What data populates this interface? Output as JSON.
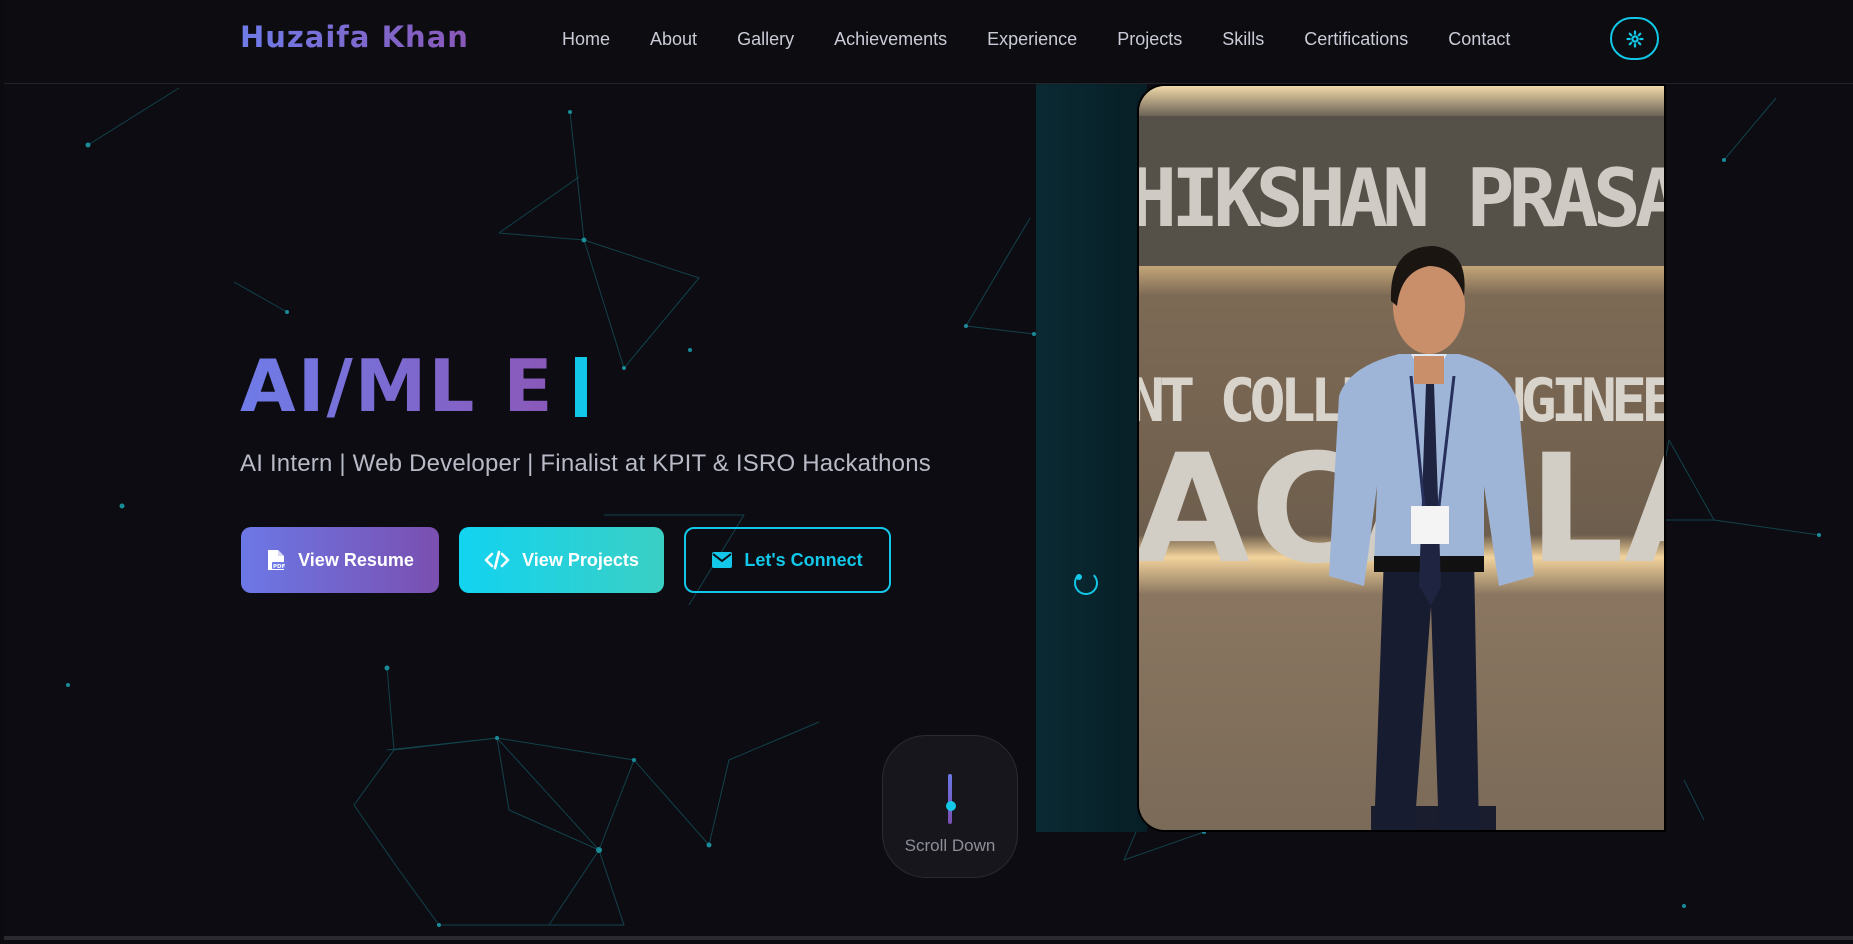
{
  "navbar": {
    "brand": "Huzaifa Khan",
    "links": [
      "Home",
      "About",
      "Gallery",
      "Achievements",
      "Experience",
      "Projects",
      "Skills",
      "Certifications",
      "Contact"
    ],
    "theme_toggle_icon": "gear-icon"
  },
  "hero": {
    "title": "AI/ML E",
    "subtitle": "AI Intern | Web Developer | Finalist at KPIT & ISRO Hackathons",
    "buttons": {
      "resume": "View Resume",
      "projects": "View Projects",
      "connect": "Let's Connect"
    },
    "scroll_label": "Scroll Down"
  },
  "photo": {
    "wall_text_top": "HIKSHAN PRASARAK",
    "wall_text_mid": "NT COLLEGE  ENGINEER",
    "wall_text_big": "ACA  LA"
  },
  "colors": {
    "accent_cyan": "#13c7e8",
    "gradient_start": "#6c78e6",
    "gradient_end": "#7a4fb0",
    "background": "#0c0c12"
  }
}
